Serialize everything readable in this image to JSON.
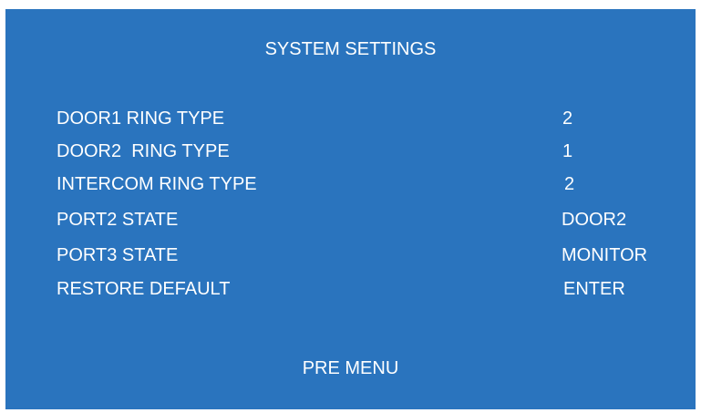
{
  "screen": {
    "title": "SYSTEM SETTINGS",
    "background_color": "#2a74be",
    "text_color": "#ffffff"
  },
  "settings": [
    {
      "label": "DOOR1 RING TYPE",
      "value": "2"
    },
    {
      "label": "DOOR2  RING TYPE",
      "value": "1"
    },
    {
      "label": "INTERCOM RING TYPE",
      "value": "2"
    },
    {
      "label": "PORT2 STATE",
      "value": "DOOR2"
    },
    {
      "label": "PORT3 STATE",
      "value": "MONITOR"
    },
    {
      "label": "RESTORE DEFAULT",
      "value": "ENTER"
    }
  ],
  "footer": {
    "pre_menu_label": "PRE MENU"
  }
}
